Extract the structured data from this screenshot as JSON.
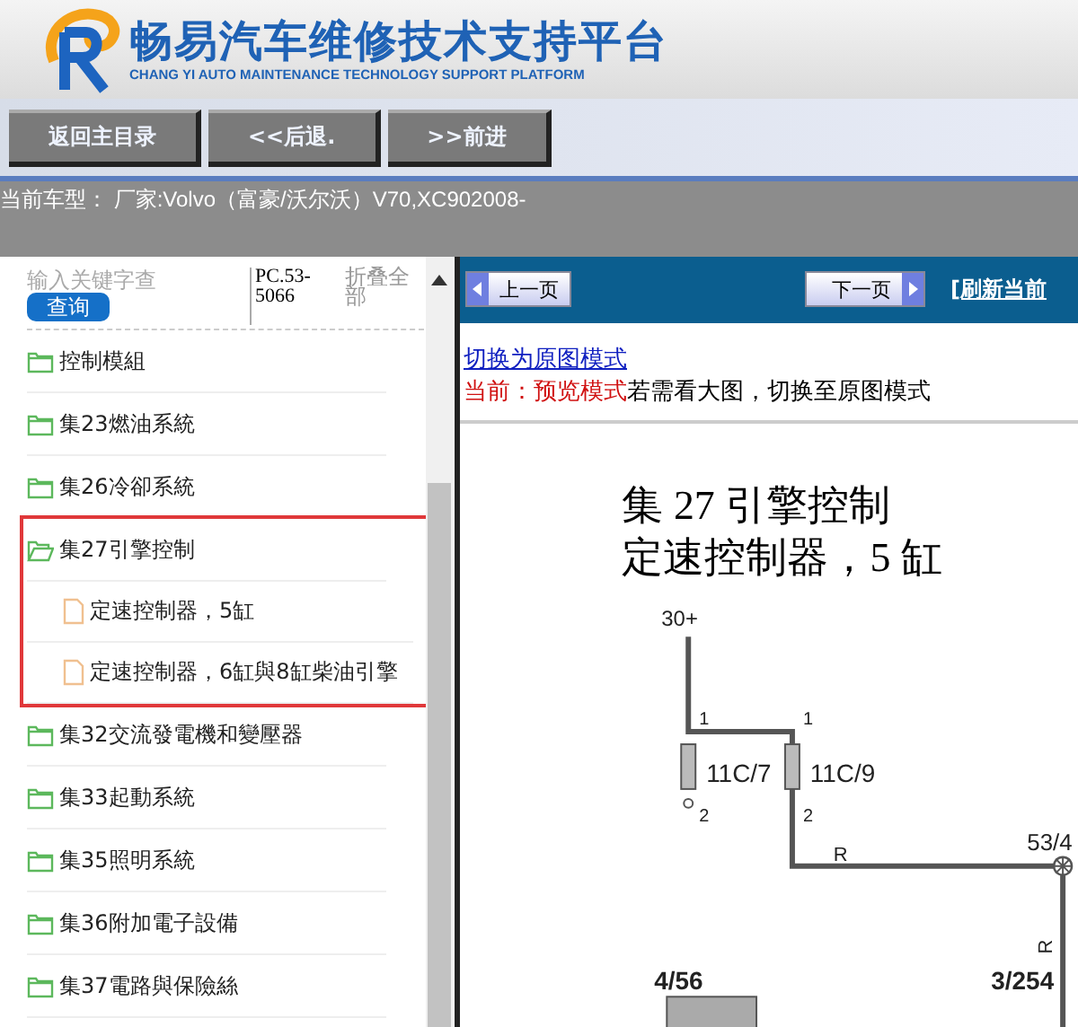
{
  "header": {
    "title": "畅易汽车维修技术支持平台",
    "subtitle": "CHANG YI AUTO MAINTENANCE TECHNOLOGY SUPPORT PLATFORM"
  },
  "nav_buttons": [
    "返回主目录",
    "<<后退.",
    ">>前进"
  ],
  "vehicle_info": "当前车型： 厂家:Volvo（富豪/沃尔沃）V70,XC902008-",
  "sidebar": {
    "search": {
      "placeholder": "输入关键字查",
      "button": "查询"
    },
    "code": "PC.53-5066",
    "collapse_all": "折叠全部",
    "tree": [
      {
        "label": "控制模組",
        "expanded": false,
        "highlighted": false
      },
      {
        "label": "集23燃油系統",
        "expanded": false,
        "highlighted": false
      },
      {
        "label": "集26冷卻系統",
        "expanded": false,
        "highlighted": false
      },
      {
        "label": "集27引擎控制",
        "expanded": true,
        "highlighted": true,
        "children": [
          {
            "label": "定速控制器，5缸"
          },
          {
            "label": "定速控制器，6缸與8缸柴油引擎"
          }
        ]
      },
      {
        "label": "集32交流發電機和變壓器",
        "expanded": false,
        "highlighted": false
      },
      {
        "label": "集33起動系統",
        "expanded": false,
        "highlighted": false
      },
      {
        "label": "集35照明系統",
        "expanded": false,
        "highlighted": false
      },
      {
        "label": "集36附加電子設備",
        "expanded": false,
        "highlighted": false
      },
      {
        "label": "集37電路與保險絲",
        "expanded": false,
        "highlighted": false
      }
    ]
  },
  "toolbar": {
    "prev_page": "上一页",
    "next_page": "下一页",
    "refresh": "[刷新当前"
  },
  "mode": {
    "switch_link": "切换为原图模式",
    "current": "当前：预览模式",
    "hint": "若需看大图，切换至原图模式"
  },
  "diagram": {
    "title": "集 27 引擎控制",
    "subtitle": "定速控制器，5 缸",
    "labels": [
      "30+",
      "1",
      "1",
      "11C/7",
      "11C/9",
      "2",
      "2",
      "R",
      "53/4",
      "R",
      "4/56",
      "3/254"
    ]
  }
}
